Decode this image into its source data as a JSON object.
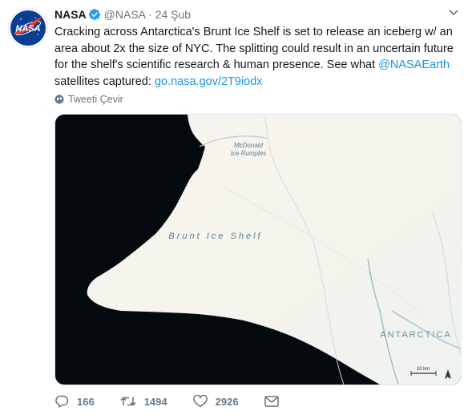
{
  "author": {
    "name": "NASA",
    "handle": "@NASA",
    "separator": "·",
    "date": "24 Şub",
    "avatar_label": "NASA"
  },
  "tweet": {
    "text_before_mention": "Cracking across Antarctica's Brunt Ice Shelf is set to release an iceberg w/ an area about 2x the size of NYC. The splitting could result in an uncertain future for the shelf's scientific research & human presence. See what ",
    "mention": "@NASAEarth",
    "text_after_mention": " satellites captured: ",
    "link": "go.nasa.gov/2T9iodx"
  },
  "translate_label": "Tweeti Çevir",
  "media": {
    "label_rumples_line1": "McDonald",
    "label_rumples_line2": "Ice Rumples",
    "label_shelf": "Brunt Ice Shelf",
    "label_continent": "ANTARCTICA",
    "scale_label": "10 km",
    "north_label": "N"
  },
  "actions": {
    "replies": "166",
    "retweets": "1494",
    "likes": "2926"
  },
  "colors": {
    "accent": "#1b95e0",
    "verified": "#1da1f2",
    "muted": "#657786",
    "nasa_blue": "#0b3d91",
    "nasa_red": "#fc3d21"
  },
  "icons": [
    "nasa-logo",
    "verified-badge-icon",
    "chevron-down-icon",
    "globe-icon",
    "reply-icon",
    "retweet-icon",
    "like-icon",
    "direct-message-icon",
    "north-arrow-icon"
  ]
}
